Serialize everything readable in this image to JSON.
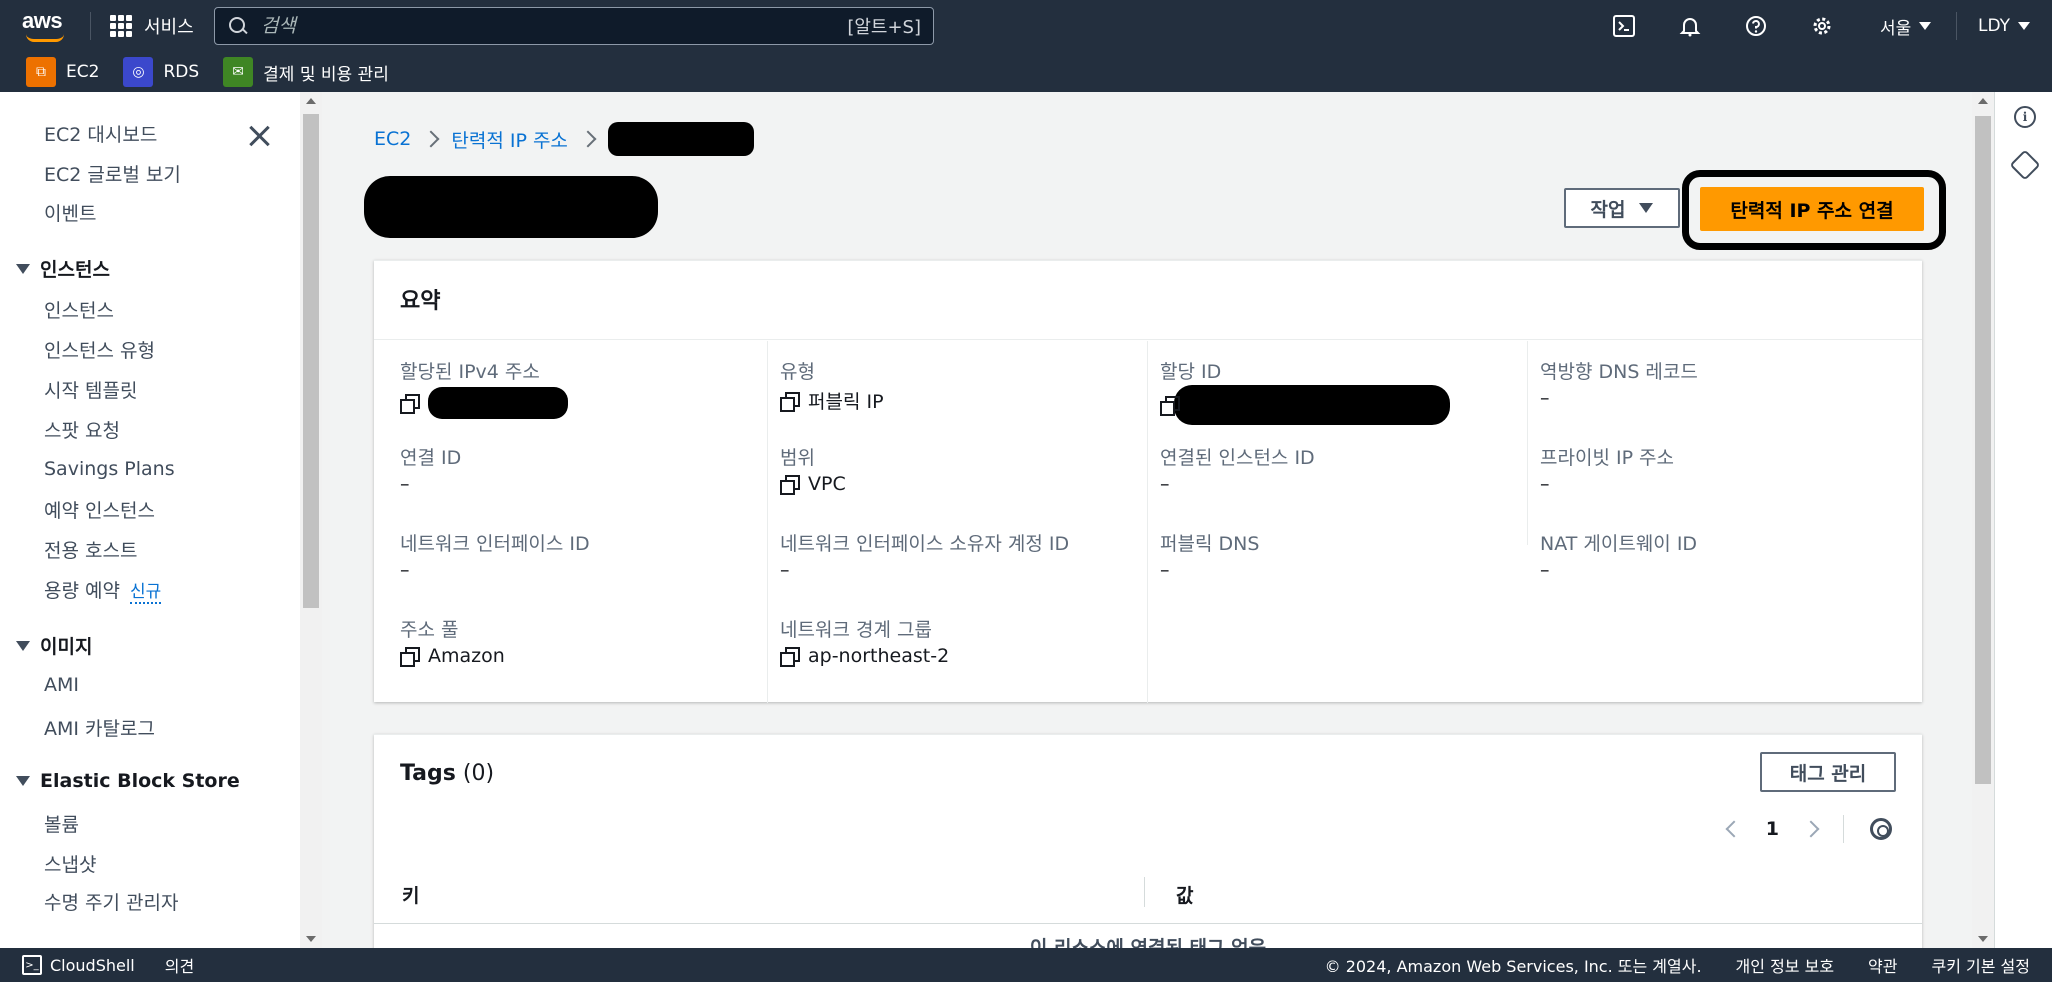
{
  "topnav": {
    "logo_text": "aws",
    "services_label": "서비스",
    "search_placeholder": "검색",
    "search_shortcut": "[알트+S]",
    "region": "서울",
    "user": "LDY"
  },
  "favorites": [
    {
      "label": "EC2",
      "color": "#ed7100",
      "icon": "ec2-icon"
    },
    {
      "label": "RDS",
      "color": "#3b48cc",
      "icon": "rds-icon"
    },
    {
      "label": "결제 및 비용 관리",
      "color": "#3f8624",
      "icon": "billing-icon"
    }
  ],
  "sidebar": {
    "top_items": [
      "EC2 대시보드",
      "EC2 글로벌 보기",
      "이벤트"
    ],
    "instances_head": "인스턴스",
    "instances_items": [
      "인스턴스",
      "인스턴스 유형",
      "시작 템플릿",
      "스팟 요청",
      "Savings Plans",
      "예약 인스턴스",
      "전용 호스트",
      "용량 예약"
    ],
    "new_badge": "신규",
    "images_head": "이미지",
    "images_items": [
      "AMI",
      "AMI 카탈로그"
    ],
    "ebs_head": "Elastic Block Store",
    "ebs_items": [
      "볼륨",
      "스냅샷",
      "수명 주기 관리자"
    ]
  },
  "breadcrumb": {
    "root": "EC2",
    "parent": "탄력적 IP 주소"
  },
  "actions": {
    "actions_label": "작업",
    "associate_label": "탄력적 IP 주소 연결"
  },
  "summary": {
    "title": "요약",
    "fields": {
      "ipv4_label": "할당된 IPv4 주소",
      "type_label": "유형",
      "type_value": "퍼블릭 IP",
      "alloc_label": "할당 ID",
      "rdns_label": "역방향 DNS 레코드",
      "rdns_value": "–",
      "assoc_label": "연결 ID",
      "assoc_value": "–",
      "scope_label": "범위",
      "scope_value": "VPC",
      "inst_label": "연결된 인스턴스 ID",
      "inst_value": "–",
      "privip_label": "프라이빗 IP 주소",
      "privip_value": "–",
      "eni_label": "네트워크 인터페이스 ID",
      "eni_value": "–",
      "eniowner_label": "네트워크 인터페이스 소유자 계정 ID",
      "eniowner_value": "–",
      "pubdns_label": "퍼블릭 DNS",
      "pubdns_value": "–",
      "natgw_label": "NAT 게이트웨이 ID",
      "natgw_value": "–",
      "pool_label": "주소 풀",
      "pool_value": "Amazon",
      "nbg_label": "네트워크 경계 그룹",
      "nbg_value": "ap-northeast-2"
    }
  },
  "tags": {
    "title": "Tags",
    "count": "(0)",
    "manage_label": "태그 관리",
    "page": "1",
    "col_key": "키",
    "col_value": "값",
    "empty": "이 리소스에 연결된 태그 없음"
  },
  "footer": {
    "cloudshell": "CloudShell",
    "feedback": "의견",
    "copyright": "© 2024, Amazon Web Services, Inc. 또는 계열사.",
    "privacy": "개인 정보 보호",
    "terms": "약관",
    "cookies": "쿠키 기본 설정"
  }
}
